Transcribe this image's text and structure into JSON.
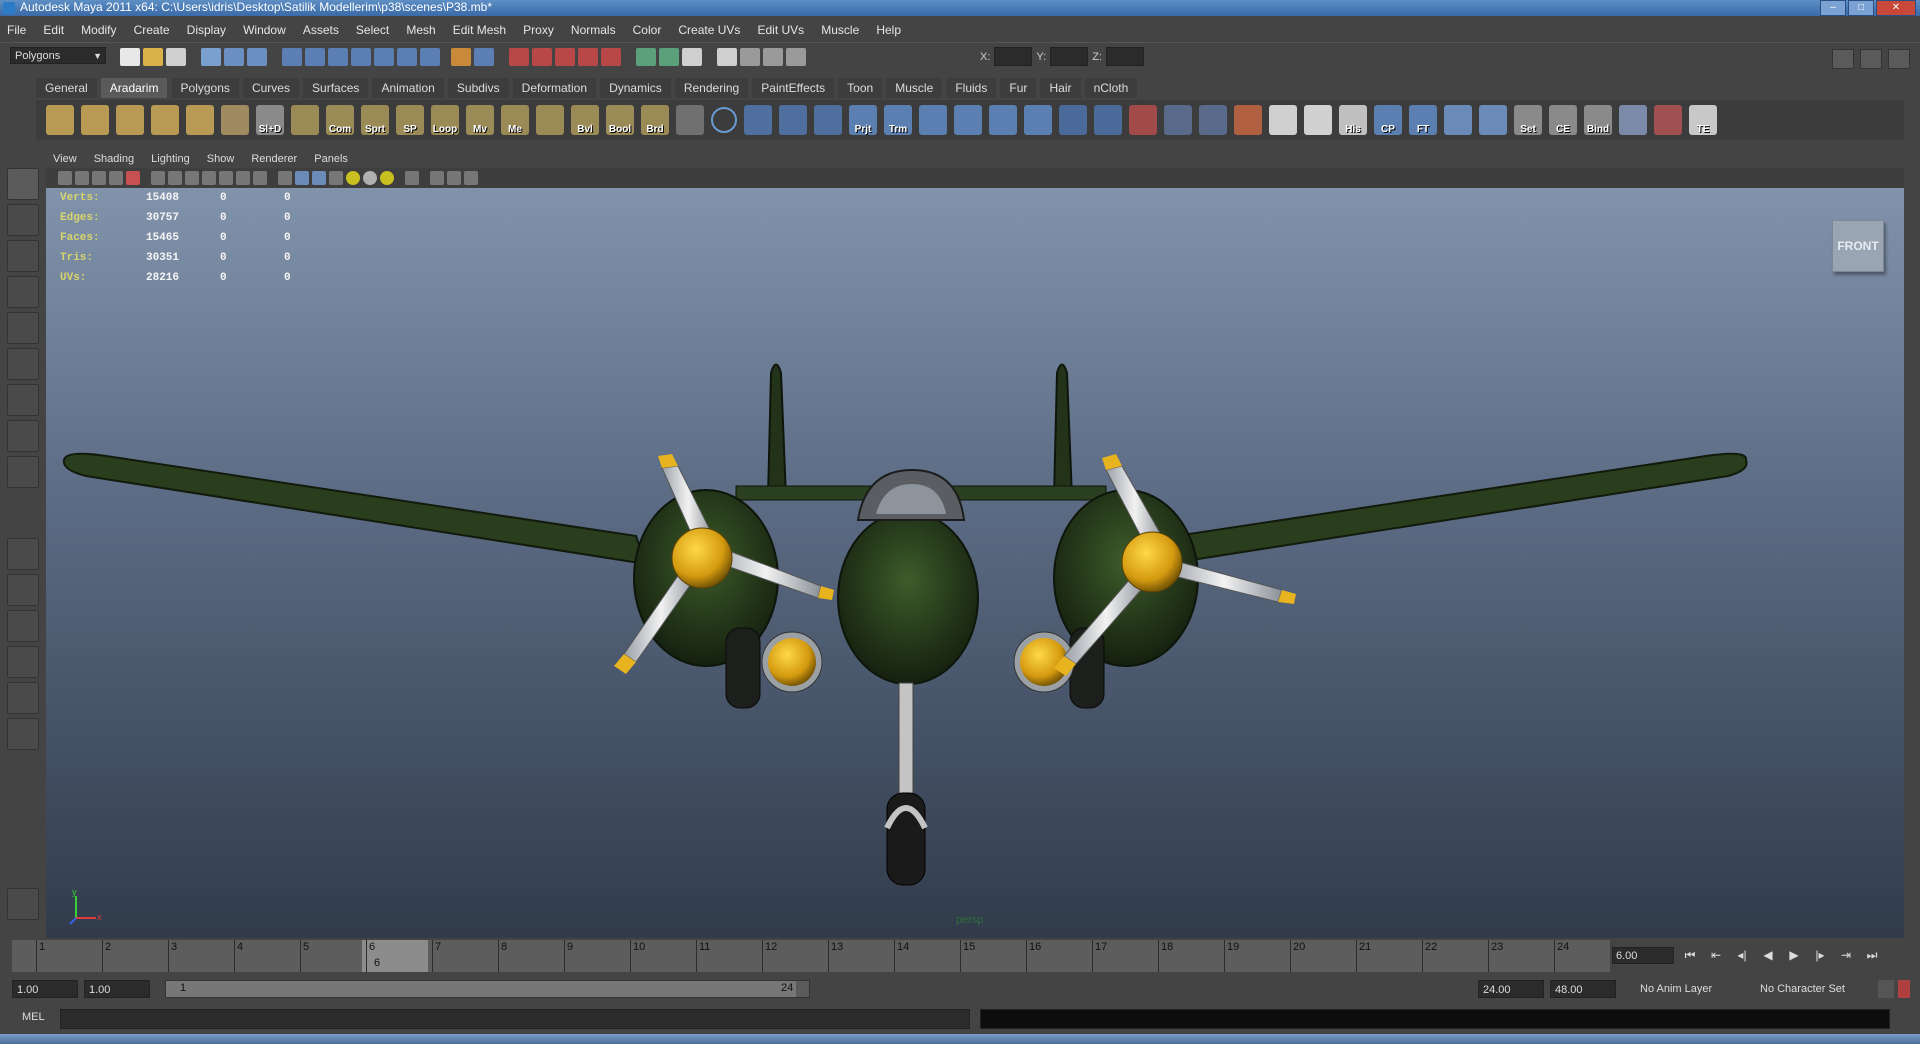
{
  "window": {
    "title": "Autodesk Maya 2011 x64: C:\\Users\\idris\\Desktop\\Satilik Modellerim\\p38\\scenes\\P38.mb*"
  },
  "menu": [
    "File",
    "Edit",
    "Modify",
    "Create",
    "Display",
    "Window",
    "Assets",
    "Select",
    "Mesh",
    "Edit Mesh",
    "Proxy",
    "Normals",
    "Color",
    "Create UVs",
    "Edit UVs",
    "Muscle",
    "Help"
  ],
  "statusline": {
    "mode": "Polygons",
    "x_label": "X:",
    "y_label": "Y:",
    "z_label": "Z:"
  },
  "shelf_tabs": [
    "General",
    "Aradarim",
    "Polygons",
    "Curves",
    "Surfaces",
    "Animation",
    "Subdivs",
    "Deformation",
    "Dynamics",
    "Rendering",
    "PaintEffects",
    "Toon",
    "Muscle",
    "Fluids",
    "Fur",
    "Hair",
    "nCloth"
  ],
  "shelf_active": "Aradarim",
  "shelf_labels": {
    "s1": "Sl+D",
    "s2": "Com",
    "s3": "Sprt",
    "s4": "SP",
    "s5": "Loop",
    "s6": "Mv",
    "s7": "Me",
    "s8": "Bvl",
    "s9": "Bool",
    "s10": "Brd",
    "s11": "Prjt",
    "s12": "Trm",
    "s13": "His",
    "s14": "CP",
    "s15": "FT",
    "s16": "Set",
    "s17": "CE",
    "s18": "Bind",
    "s19": "TE"
  },
  "panel_menu": [
    "View",
    "Shading",
    "Lighting",
    "Show",
    "Renderer",
    "Panels"
  ],
  "hud": {
    "verts": {
      "label": "Verts:",
      "v1": "15408",
      "v2": "0",
      "v3": "0"
    },
    "edges": {
      "label": "Edges:",
      "v1": "30757",
      "v2": "0",
      "v3": "0"
    },
    "faces": {
      "label": "Faces:",
      "v1": "15465",
      "v2": "0",
      "v3": "0"
    },
    "tris": {
      "label": "Tris:",
      "v1": "30351",
      "v2": "0",
      "v3": "0"
    },
    "uvs": {
      "label": "UVs:",
      "v1": "28216",
      "v2": "0",
      "v3": "0"
    }
  },
  "viewcube_label": "FRONT",
  "camera_label": "persp",
  "axis_labels": {
    "y": "y",
    "x": "x"
  },
  "timeline": {
    "ticks": [
      "1",
      "2",
      "3",
      "4",
      "5",
      "6",
      "7",
      "8",
      "9",
      "10",
      "11",
      "12",
      "13",
      "14",
      "15",
      "16",
      "17",
      "18",
      "19",
      "20",
      "21",
      "22",
      "23",
      "24"
    ],
    "current_frame_marker": "6",
    "current_time": "6.00"
  },
  "range": {
    "start_time": "1.00",
    "playback_start": "1.00",
    "range_start_label": "1",
    "range_end_label": "24",
    "playback_end": "24.00",
    "end_time": "48.00",
    "anim_layer": "No Anim Layer",
    "character_set": "No Character Set"
  },
  "mel_label": "MEL",
  "colors": {
    "viewport_top": "#8193ab",
    "viewport_bottom": "#313b4a",
    "aircraft_green": "#2f4a22",
    "spinner_yellow": "#e0a820",
    "hud_label": "#d8d56a"
  }
}
